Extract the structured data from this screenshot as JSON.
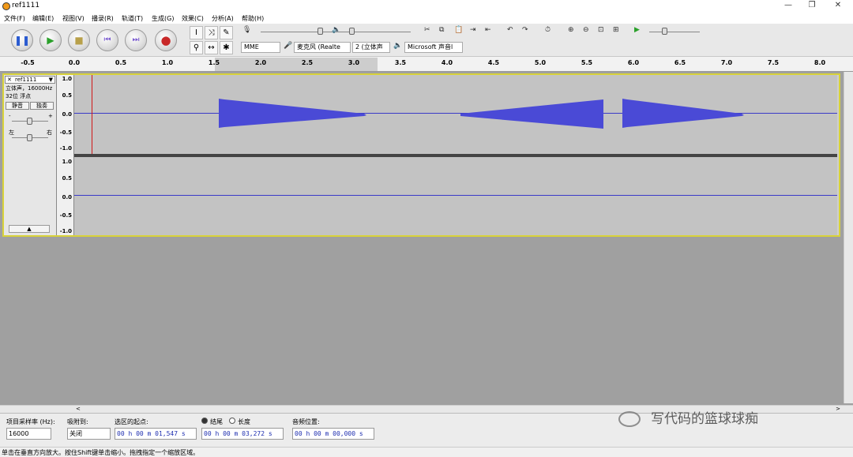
{
  "window": {
    "title": "ref1111",
    "minimize": "—",
    "maximize": "❐",
    "close": "✕"
  },
  "menu": [
    "文件(F)",
    "编辑(E)",
    "视图(V)",
    "播录(R)",
    "轨道(T)",
    "生成(G)",
    "效果(C)",
    "分析(A)",
    "帮助(H)"
  ],
  "transport": {
    "pause": "❚❚",
    "play": "▶",
    "stop": "■",
    "skip_start": "⏮",
    "skip_end": "⏭",
    "record": "●"
  },
  "tools": {
    "select": "I",
    "envelope": "⤨",
    "draw": "✎",
    "zoom": "⚲",
    "timeshift": "↔",
    "multi": "✱"
  },
  "device": {
    "host": "MME",
    "mic_device": "麦克风 (Realte",
    "channels": "2 (立体声",
    "output_device": "Microsoft 声音l"
  },
  "ruler": {
    "ticks": [
      "-0.5",
      "0.0",
      "0.5",
      "1.0",
      "1.5",
      "2.0",
      "2.5",
      "3.0",
      "3.5",
      "4.0",
      "4.5",
      "5.0",
      "5.5",
      "6.0",
      "6.5",
      "7.0",
      "7.5",
      "8.0"
    ],
    "selection_start": 1.547,
    "selection_end": 3.272
  },
  "track": {
    "name": "ref1111",
    "info_line1": "立体声，16000Hz",
    "info_line2": "32位 浮点",
    "mute": "静音",
    "solo": "独奏",
    "gain_minus": "-",
    "gain_plus": "+",
    "pan_left": "左",
    "pan_right": "右",
    "vscale": [
      "1.0",
      "0.5",
      "0.0",
      "-0.5",
      "-1.0"
    ]
  },
  "selection_toolbar": {
    "rate_label": "项目采样率 (Hz):",
    "rate_value": "16000",
    "snap_label": "吸附到:",
    "snap_value": "关闭",
    "start_label": "选区的起点:",
    "start_value": "00 h 00 m 01,547 s",
    "end_label": "结尾",
    "length_label": "长度",
    "end_value": "00 h 00 m 03,272 s",
    "audio_pos_label": "音频位置:",
    "audio_pos_value": "00 h 00 m 00,000 s"
  },
  "status": "单击在垂直方向放大。按住Shift键单击缩小。拖拽指定一个缩放区域。",
  "watermark": "写代码的篮球球痴",
  "colors": {
    "waveform": "#4a4ad6",
    "selection_border": "#d8d23a",
    "cursor": "#d01818"
  }
}
